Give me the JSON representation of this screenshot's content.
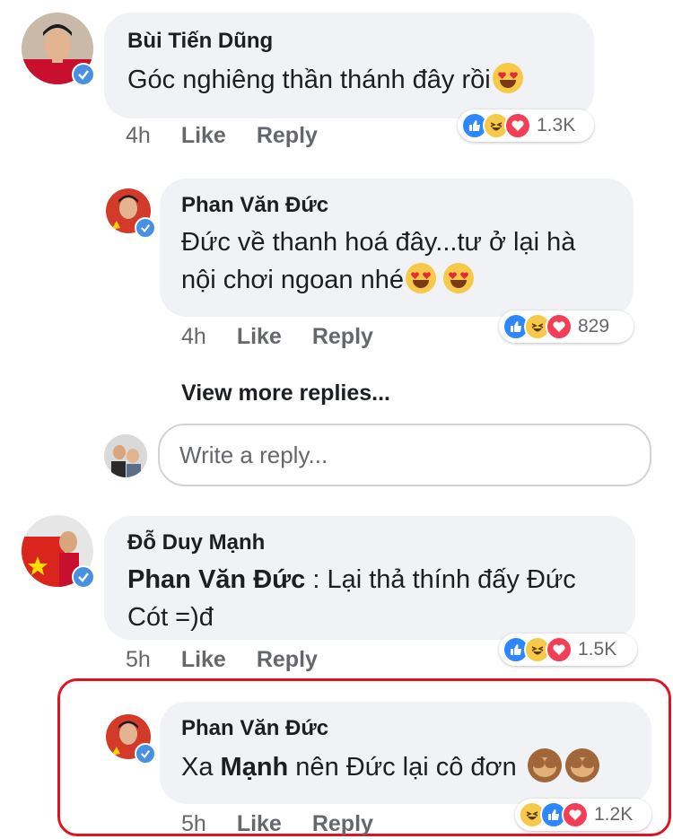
{
  "comments": [
    {
      "author": "Bùi Tiến Dũng",
      "text": "Góc nghiêng thần thánh đây rồi",
      "time": "4h",
      "like": "Like",
      "reply": "Reply",
      "reaction_count": "1.3K"
    },
    {
      "author": "Phan Văn Đức",
      "text": "Đức về thanh hoá đây...tư ở lại hà nội chơi ngoan nhé",
      "time": "4h",
      "like": "Like",
      "reply": "Reply",
      "reaction_count": "829"
    },
    {
      "author": "Đỗ Duy Mạnh",
      "mention": "Phan Văn Đức",
      "text": " : Lại thả thính đấy Đức Cót =)đ",
      "time": "5h",
      "like": "Like",
      "reply": "Reply",
      "reaction_count": "1.5K"
    },
    {
      "author": "Phan Văn Đức",
      "text_before": "Xa ",
      "text_bold": "Mạnh",
      "text_after": " nên Đức lại cô đơn",
      "time": "5h",
      "like": "Like",
      "reply": "Reply",
      "reaction_count": "1.2K"
    }
  ],
  "view_more_replies": "View more replies...",
  "reply_input": {
    "placeholder": "Write a reply..."
  },
  "colors": {
    "bubble": "#f0f2f5",
    "meta": "#65676b",
    "highlight": "#e0141e",
    "like": "#2d88ff",
    "love": "#f33e58",
    "haha": "#f7c948"
  }
}
